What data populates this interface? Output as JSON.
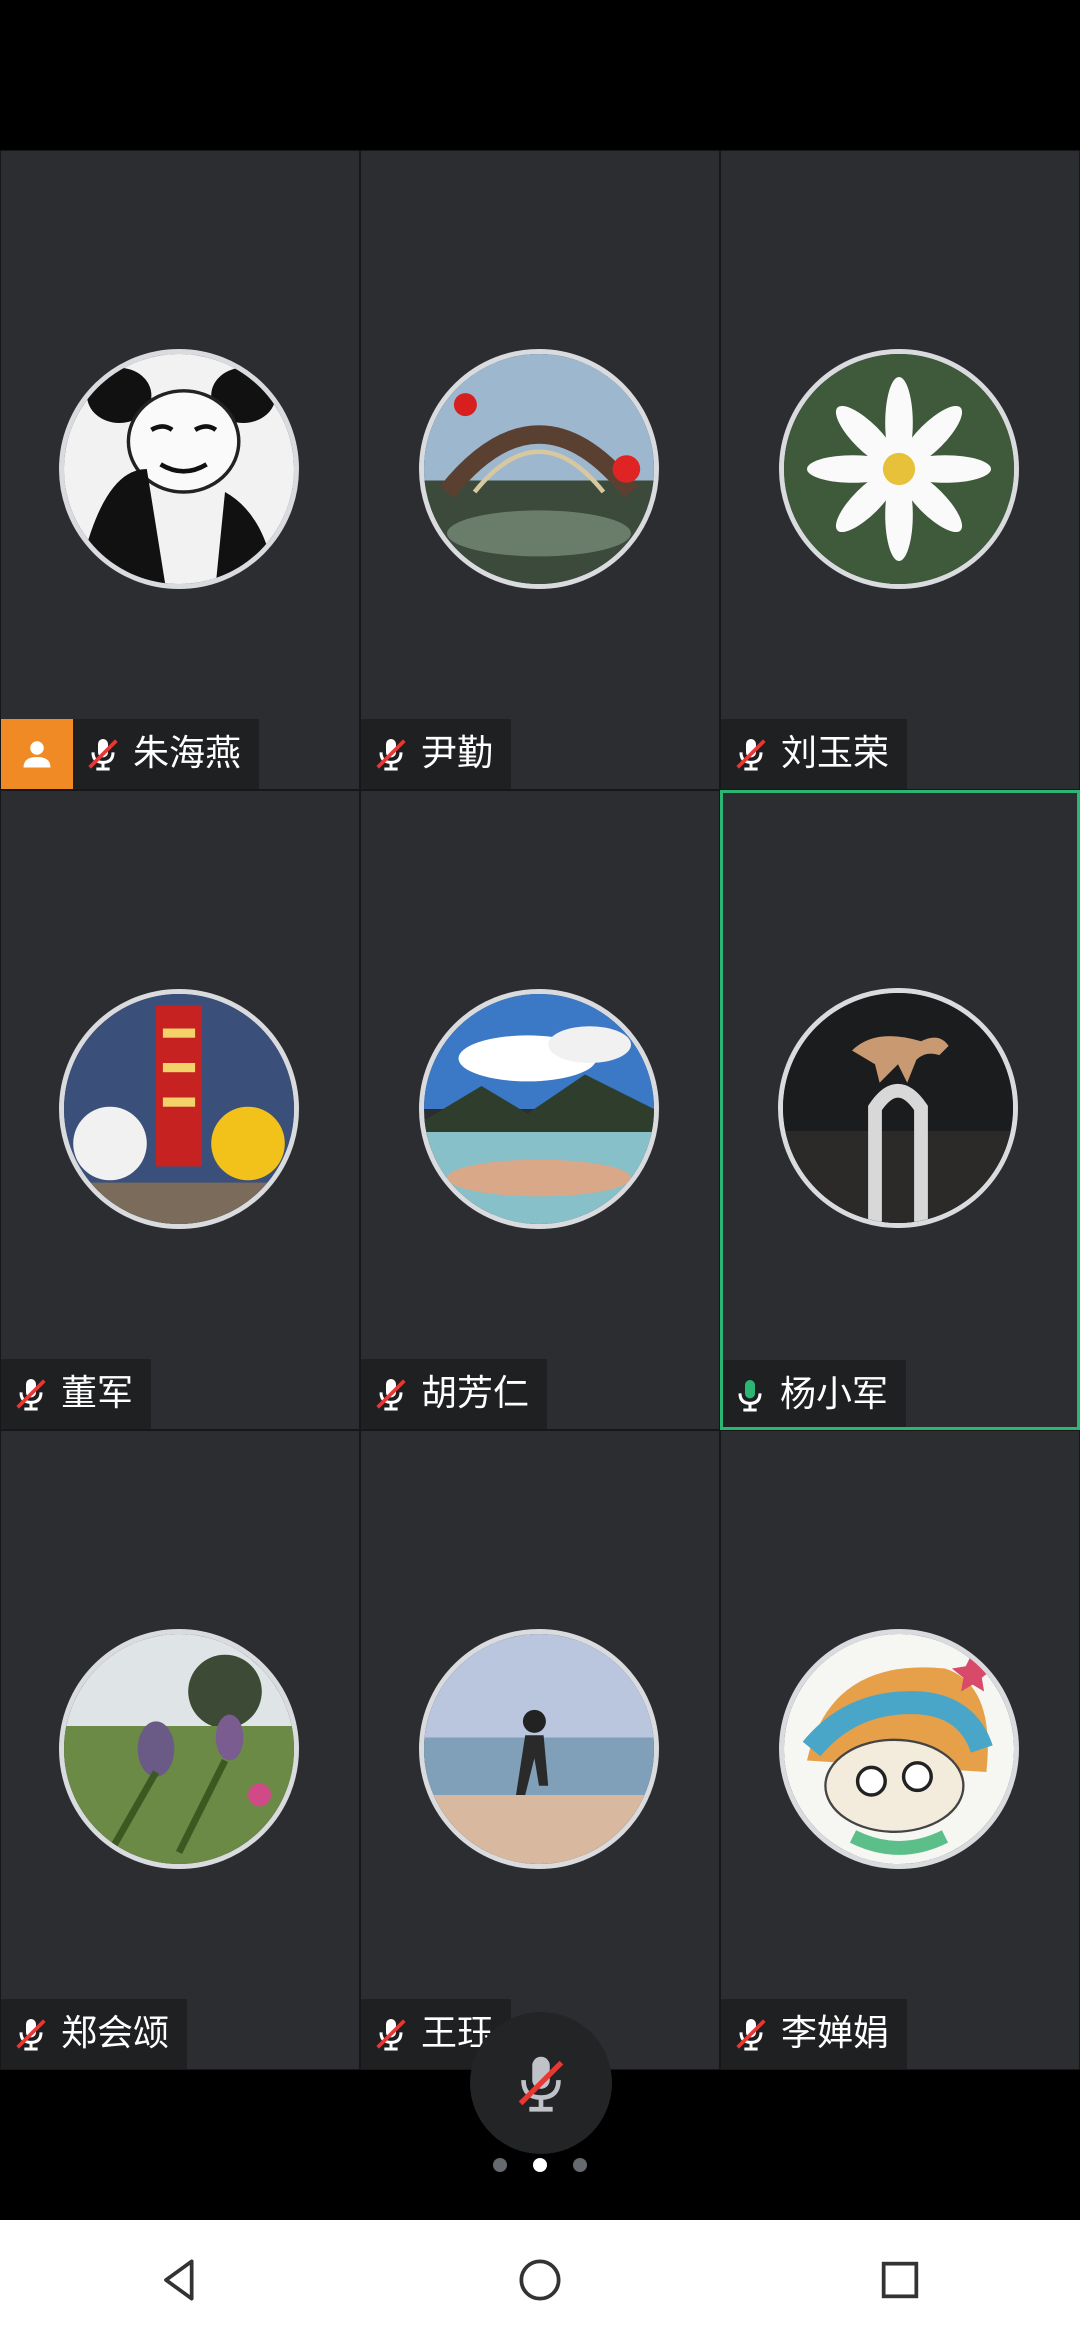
{
  "participants": [
    {
      "name": "朱海燕",
      "is_host": true,
      "mic": "muted",
      "speaking": false,
      "avatar": "panda-meme-avatar"
    },
    {
      "name": "尹勤",
      "is_host": false,
      "mic": "muted",
      "speaking": false,
      "avatar": "bridge-avatar"
    },
    {
      "name": "刘玉荣",
      "is_host": false,
      "mic": "muted",
      "speaking": false,
      "avatar": "flower-avatar"
    },
    {
      "name": "董军",
      "is_host": false,
      "mic": "muted",
      "speaking": false,
      "avatar": "lion-dance-avatar"
    },
    {
      "name": "胡芳仁",
      "is_host": false,
      "mic": "muted",
      "speaking": false,
      "avatar": "lake-avatar"
    },
    {
      "name": "杨小军",
      "is_host": false,
      "mic": "active",
      "speaking": true,
      "avatar": "horse-sculpture-avatar"
    },
    {
      "name": "郑会颂",
      "is_host": false,
      "mic": "muted",
      "speaking": false,
      "avatar": "wildflowers-avatar"
    },
    {
      "name": "王珏",
      "is_host": false,
      "mic": "muted",
      "speaking": false,
      "avatar": "beach-person-avatar"
    },
    {
      "name": "李婵娟",
      "is_host": false,
      "mic": "muted",
      "speaking": false,
      "avatar": "cartoon-girl-avatar"
    }
  ],
  "controls": {
    "mic_button_icon": "mic-muted-icon"
  },
  "pager": {
    "total": 3,
    "current": 2
  },
  "colors": {
    "host_badge": "#f08a24",
    "speaking_border": "#2bb673",
    "mic_active": "#2bb673",
    "mic_muted_slash": "#e53935"
  },
  "nav": {
    "icons": [
      "back-icon",
      "home-icon",
      "recents-icon"
    ]
  }
}
